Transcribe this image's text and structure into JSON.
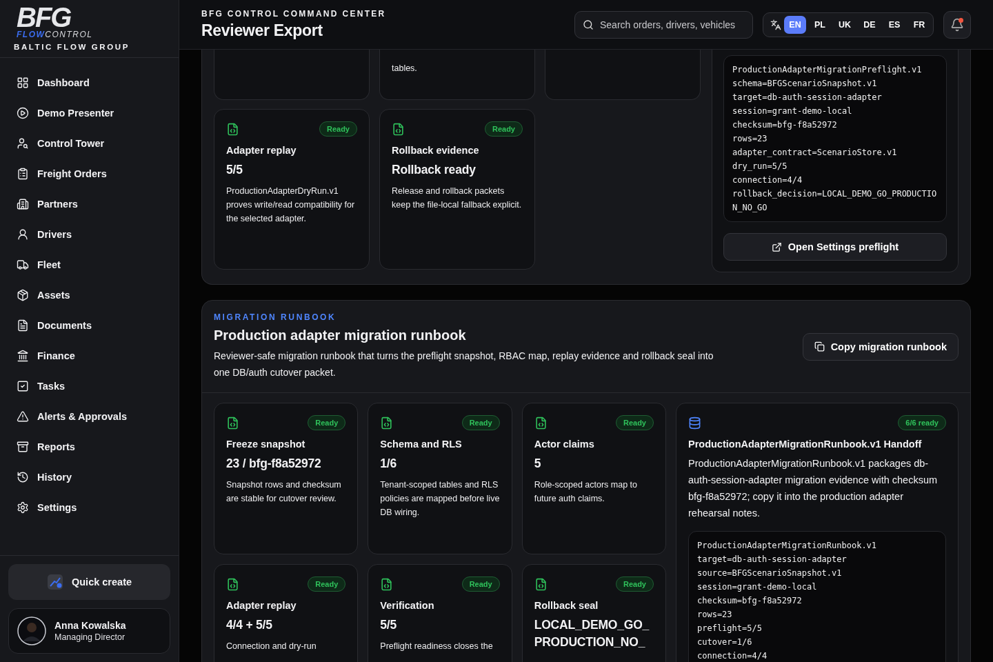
{
  "brand": {
    "logo_top": "BFG",
    "logo_flow": "FLOW",
    "logo_control": "CONTROL",
    "tagline": "BALTIC FLOW GROUP"
  },
  "sidebar": {
    "items": [
      {
        "label": "Dashboard",
        "selected": false
      },
      {
        "label": "Demo Presenter",
        "selected": false
      },
      {
        "label": "Control Tower",
        "selected": false
      },
      {
        "label": "Freight Orders",
        "selected": false
      },
      {
        "label": "Partners",
        "selected": false
      },
      {
        "label": "Drivers",
        "selected": false
      },
      {
        "label": "Fleet",
        "selected": false
      },
      {
        "label": "Assets",
        "selected": false
      },
      {
        "label": "Documents",
        "selected": false
      },
      {
        "label": "Finance",
        "selected": false
      },
      {
        "label": "Tasks",
        "selected": false
      },
      {
        "label": "Alerts & Approvals",
        "selected": false
      },
      {
        "label": "Reports",
        "selected": false
      },
      {
        "label": "History",
        "selected": false
      },
      {
        "label": "Settings",
        "selected": false
      }
    ],
    "quick_create": "Quick create",
    "user": {
      "name": "Anna Kowalska",
      "role": "Managing Director"
    }
  },
  "header": {
    "eyebrow": "BFG CONTROL COMMAND CENTER",
    "title": "Reviewer Export",
    "search": {
      "placeholder": "Search orders, drivers, vehicles"
    },
    "languages": [
      {
        "label": "EN",
        "selected": true
      },
      {
        "label": "PL",
        "selected": false
      },
      {
        "label": "UK",
        "selected": false
      },
      {
        "label": "DE",
        "selected": false
      },
      {
        "label": "ES",
        "selected": false
      },
      {
        "label": "FR",
        "selected": false
      }
    ],
    "notifications": {
      "unread": true
    }
  },
  "preflight_section": {
    "top_cards": [
      {
        "kind": "blank"
      },
      {
        "kind": "text",
        "text": "tables."
      },
      {
        "kind": "blank"
      }
    ],
    "cards": [
      {
        "status": "Ready",
        "title": "Adapter replay",
        "value": "5/5",
        "text": "ProductionAdapterDryRun.v1 proves write/read compatibility for the selected adapter."
      },
      {
        "status": "Ready",
        "title": "Rollback evidence",
        "value": "Rollback ready",
        "text": "Release and rollback packets keep the file-local fallback explicit."
      }
    ],
    "code": [
      "ProductionAdapterMigrationPreflight.v1",
      "schema=BFGScenarioSnapshot.v1",
      "target=db-auth-session-adapter",
      "session=grant-demo-local",
      "checksum=bfg-f8a52972",
      "rows=23",
      "adapter_contract=ScenarioStore.v1",
      "dry_run=5/5",
      "connection=4/4",
      "rollback_decision=LOCAL_DEMO_GO_PRODUCTION_NO_GO"
    ],
    "button": "Open Settings preflight"
  },
  "runbook_section": {
    "eyebrow": "MIGRATION RUNBOOK",
    "title": "Production adapter migration runbook",
    "description": "Reviewer-safe migration runbook that turns the preflight snapshot, RBAC map, replay evidence and rollback seal into one DB/auth cutover packet.",
    "button": "Copy migration runbook",
    "cards": [
      {
        "status": "Ready",
        "title": "Freeze snapshot",
        "value": "23 / bfg-f8a52972",
        "text": "Snapshot rows and checksum are stable for cutover review."
      },
      {
        "status": "Ready",
        "title": "Schema and RLS",
        "value": "1/6",
        "text": "Tenant-scoped tables and RLS policies are mapped before live DB wiring."
      },
      {
        "status": "Ready",
        "title": "Actor claims",
        "value": "5",
        "text": "Role-scoped actors map to future auth claims."
      },
      {
        "status": "Ready",
        "title": "Adapter replay",
        "value": "4/4 + 5/5",
        "text": "Connection and dry-run"
      },
      {
        "status": "Ready",
        "title": "Verification",
        "value": "5/5",
        "text": "Preflight readiness closes the"
      },
      {
        "status": "Ready",
        "title": "Rollback seal",
        "value": "LOCAL_DEMO_GO_PRODUCTION_NO_"
      }
    ],
    "handoff": {
      "status": "6/6 ready",
      "title": "ProductionAdapterMigrationRunbook.v1 Handoff",
      "text": "ProductionAdapterMigrationRunbook.v1 packages db-auth-session-adapter migration evidence with checksum bfg-f8a52972; copy it into the production adapter rehearsal notes.",
      "code": [
        "ProductionAdapterMigrationRunbook.v1",
        "target=db-auth-session-adapter",
        "source=BFGScenarioSnapshot.v1",
        "session=grant-demo-local",
        "checksum=bfg-f8a52972",
        "rows=23",
        "preflight=5/5",
        "cutover=1/6",
        "connection=4/4"
      ]
    }
  }
}
